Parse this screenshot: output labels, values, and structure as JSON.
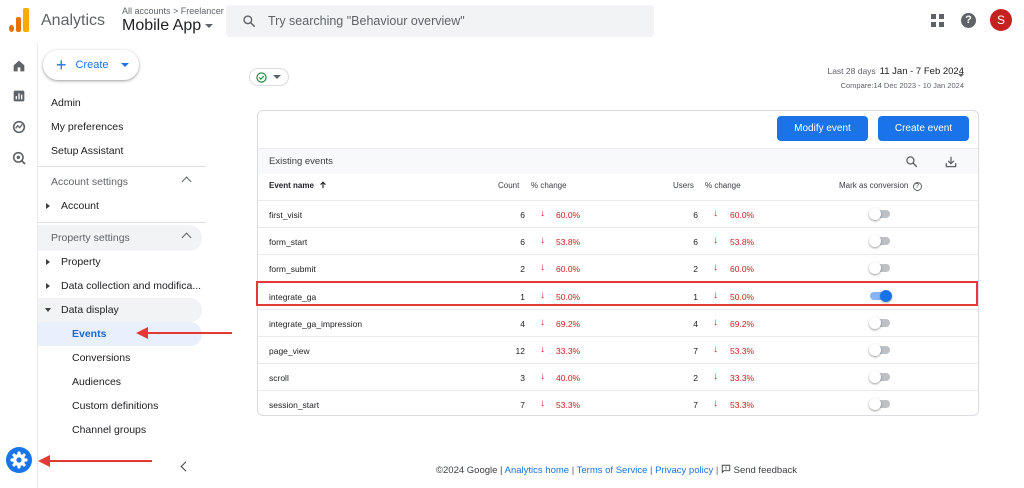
{
  "header": {
    "app_name": "Analytics",
    "account_crumb": "All accounts > Freelancer",
    "property_name": "Mobile App",
    "search_placeholder": "Try searching \"Behaviour overview\"",
    "avatar_letter": "S",
    "help_glyph": "?"
  },
  "nav": {
    "create_label": "Create",
    "create_glyph": "+",
    "items": [
      "Admin",
      "My preferences",
      "Setup Assistant"
    ],
    "account_settings": {
      "label": "Account settings",
      "children": [
        "Account"
      ]
    },
    "property_settings": {
      "label": "Property settings",
      "children": [
        "Property",
        "Data collection and modifica...",
        "Data display"
      ]
    },
    "data_display_children": [
      "Events",
      "Conversions",
      "Audiences",
      "Custom definitions",
      "Channel groups"
    ]
  },
  "main": {
    "date_label": "Last 28 days",
    "date_range": "11 Jan - 7 Feb 2024",
    "compare": "Compare:14 Dec 2023 - 10 Jan 2024",
    "modify_btn": "Modify event",
    "create_btn": "Create event",
    "card_title": "Existing events",
    "columns": {
      "event_name": "Event name",
      "count": "Count",
      "pct_change": "% change",
      "users": "Users",
      "pct_change_users": "% change",
      "mark_conversion": "Mark as conversion"
    },
    "down_arrow": "↓",
    "rows": [
      {
        "name": "first_visit",
        "count": "6",
        "count_change": "60.0%",
        "users": "6",
        "users_change": "60.0%",
        "conversion": false
      },
      {
        "name": "form_start",
        "count": "6",
        "count_change": "53.8%",
        "users": "6",
        "users_change": "53.8%",
        "conversion": false
      },
      {
        "name": "form_submit",
        "count": "2",
        "count_change": "60.0%",
        "users": "2",
        "users_change": "60.0%",
        "conversion": false
      },
      {
        "name": "integrate_ga",
        "count": "1",
        "count_change": "50.0%",
        "users": "1",
        "users_change": "50.0%",
        "conversion": true
      },
      {
        "name": "integrate_ga_impression",
        "count": "4",
        "count_change": "69.2%",
        "users": "4",
        "users_change": "69.2%",
        "conversion": false
      },
      {
        "name": "page_view",
        "count": "12",
        "count_change": "33.3%",
        "users": "7",
        "users_change": "53.3%",
        "conversion": false
      },
      {
        "name": "scroll",
        "count": "3",
        "count_change": "40.0%",
        "users": "2",
        "users_change": "33.3%",
        "conversion": false
      },
      {
        "name": "session_start",
        "count": "7",
        "count_change": "53.3%",
        "users": "7",
        "users_change": "53.3%",
        "conversion": false
      }
    ]
  },
  "footer": {
    "copyright": "©2024 Google |",
    "analytics_home": "Analytics home",
    "terms": "Terms of Service",
    "privacy": "Privacy policy",
    "feedback": "Send feedback"
  },
  "colors": {
    "accent": "#1a73e8",
    "negative": "#c5221f",
    "annotation": "#e53935"
  }
}
